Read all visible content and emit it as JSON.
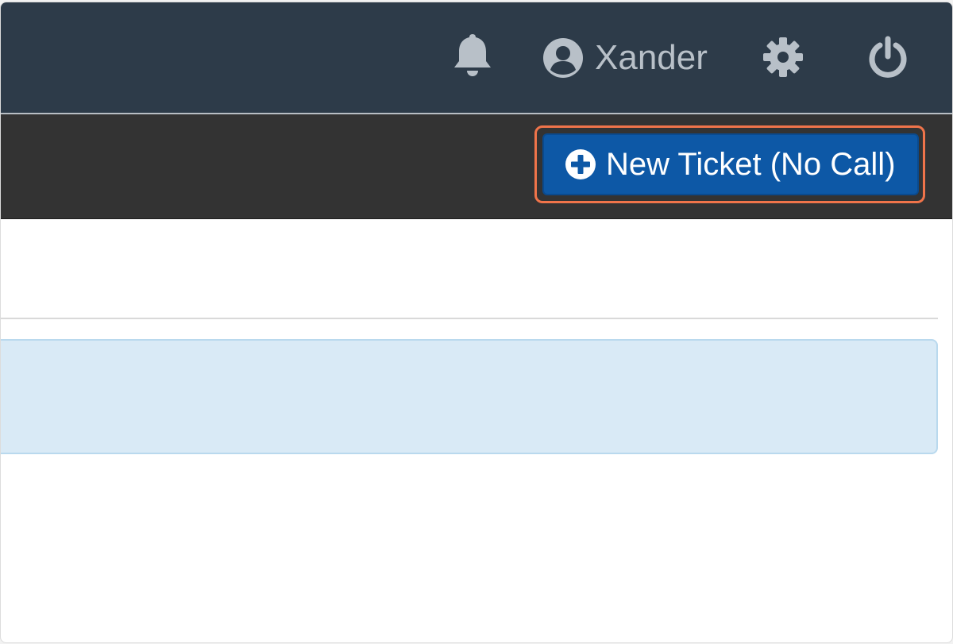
{
  "header": {
    "background": "#2d3b49",
    "user_name": "Xander",
    "icons": [
      "bell-icon",
      "user-icon",
      "gear-icon",
      "power-icon"
    ]
  },
  "actions": {
    "new_ticket_label": "New Ticket (No Call)",
    "new_ticket_icon": "plus-circle-icon",
    "button_color": "#0d58a6",
    "highlight_color": "#f0744a"
  },
  "content": {
    "info_box_color": "#d9eaf6"
  }
}
